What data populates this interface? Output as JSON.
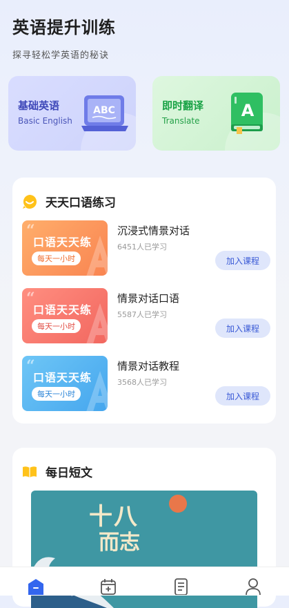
{
  "header": {
    "title": "英语提升训练",
    "subtitle": "探寻轻松学英语的秘诀"
  },
  "features": [
    {
      "title_cn": "基础英语",
      "title_en": "Basic English",
      "icon": "abc-laptop-icon",
      "color": "#3d47b8"
    },
    {
      "title_cn": "即时翻译",
      "title_en": "Translate",
      "icon": "translate-book-icon",
      "color": "#18a245"
    }
  ],
  "practice": {
    "title": "天天口语练习",
    "icon": "smile-bubble-icon",
    "courses": [
      {
        "thumb_title": "口语天天练",
        "thumb_badge": "每天一小时",
        "name": "沉浸式情景对话",
        "learners": "6451人已学习",
        "button": "加入课程"
      },
      {
        "thumb_title": "口语天天练",
        "thumb_badge": "每天一小时",
        "name": "情景对话口语",
        "learners": "5587人已学习",
        "button": "加入课程"
      },
      {
        "thumb_title": "口语天天练",
        "thumb_badge": "每天一小时",
        "name": "情景对话教程",
        "learners": "3568人已学习",
        "button": "加入课程"
      }
    ]
  },
  "article": {
    "title": "每日短文",
    "icon": "open-book-icon",
    "poster_text_1": "十八",
    "poster_text_2": "而志"
  },
  "tabbar": {
    "items": [
      {
        "icon": "home-icon",
        "active": true
      },
      {
        "icon": "calendar-add-icon",
        "active": false
      },
      {
        "icon": "document-icon",
        "active": false
      },
      {
        "icon": "user-icon",
        "active": false
      }
    ],
    "active_color": "#3366ee"
  }
}
